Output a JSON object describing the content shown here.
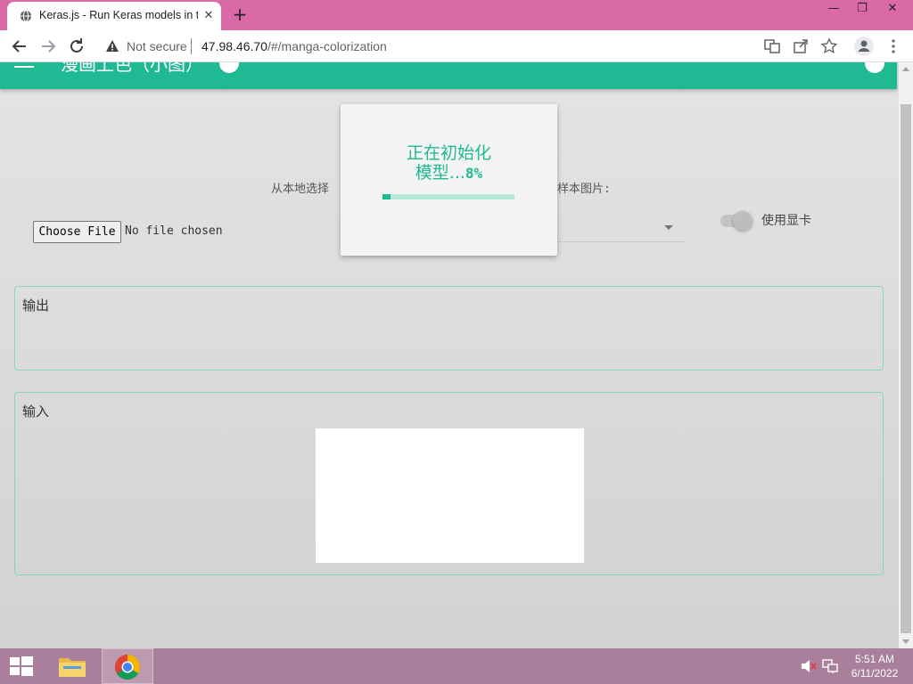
{
  "browser": {
    "tab_title": "Keras.js - Run Keras models in th",
    "tab_close": "✕",
    "new_tab": "+",
    "window_controls": {
      "minimize": "—",
      "restore": "❐",
      "close": "✕"
    },
    "security_label": "Not secure",
    "url_host": "47.98.46.70",
    "url_path": "/#/manga-colorization"
  },
  "app": {
    "title": "漫画上色（小图）",
    "select_prompt_left": "从本地选择",
    "select_prompt_right": "样本图片:",
    "file_button_label": "Choose File",
    "file_status": "No file chosen",
    "gpu_toggle_label": "使用显卡",
    "gpu_enabled": false,
    "output_title": "输出",
    "input_title": "输入",
    "loading_text_line1": "正在初始化",
    "loading_text_line2": "模型...",
    "loading_percent": "8%",
    "loading_progress": 0.06,
    "accent_color": "#1fb993"
  },
  "taskbar": {
    "items": [
      "start-icon",
      "file-explorer-icon",
      "chrome-icon"
    ],
    "active_item": "chrome-icon",
    "time": "5:51 AM",
    "date": "6/11/2022"
  }
}
